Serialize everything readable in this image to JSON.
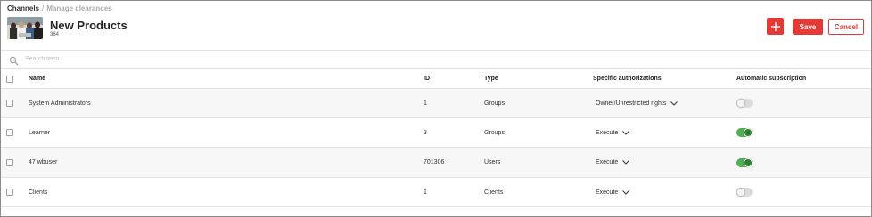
{
  "breadcrumb": {
    "items": [
      "Channels",
      "Manage clearances"
    ],
    "separator": "/"
  },
  "header": {
    "title": "New Products",
    "subtitle": "384",
    "channel_image": "group-photo-thumbnail"
  },
  "actions": {
    "add_icon": "plus-icon",
    "save_label": "Save",
    "cancel_label": "Cancel",
    "accent_color": "#e53935"
  },
  "search": {
    "placeholder": "Search term",
    "value": ""
  },
  "table": {
    "columns": [
      "Name",
      "ID",
      "Type",
      "Specific authorizations",
      "Automatic subscription"
    ],
    "rows": [
      {
        "name": "System Administrators",
        "id": "1",
        "type": "Groups",
        "authorization": "Owner/Unrestricted rights",
        "auto_subscription": false,
        "checked": false
      },
      {
        "name": "Learner",
        "id": "3",
        "type": "Groups",
        "authorization": "Execute",
        "auto_subscription": true,
        "checked": false
      },
      {
        "name": "47 wbuser",
        "id": "701306",
        "type": "Users",
        "authorization": "Execute",
        "auto_subscription": true,
        "checked": false
      },
      {
        "name": "Clients",
        "id": "1",
        "type": "Clients",
        "authorization": "Execute",
        "auto_subscription": false,
        "checked": false
      }
    ]
  },
  "colors": {
    "toggle_on": "#4caf50",
    "toggle_off": "#dcdcdc"
  }
}
